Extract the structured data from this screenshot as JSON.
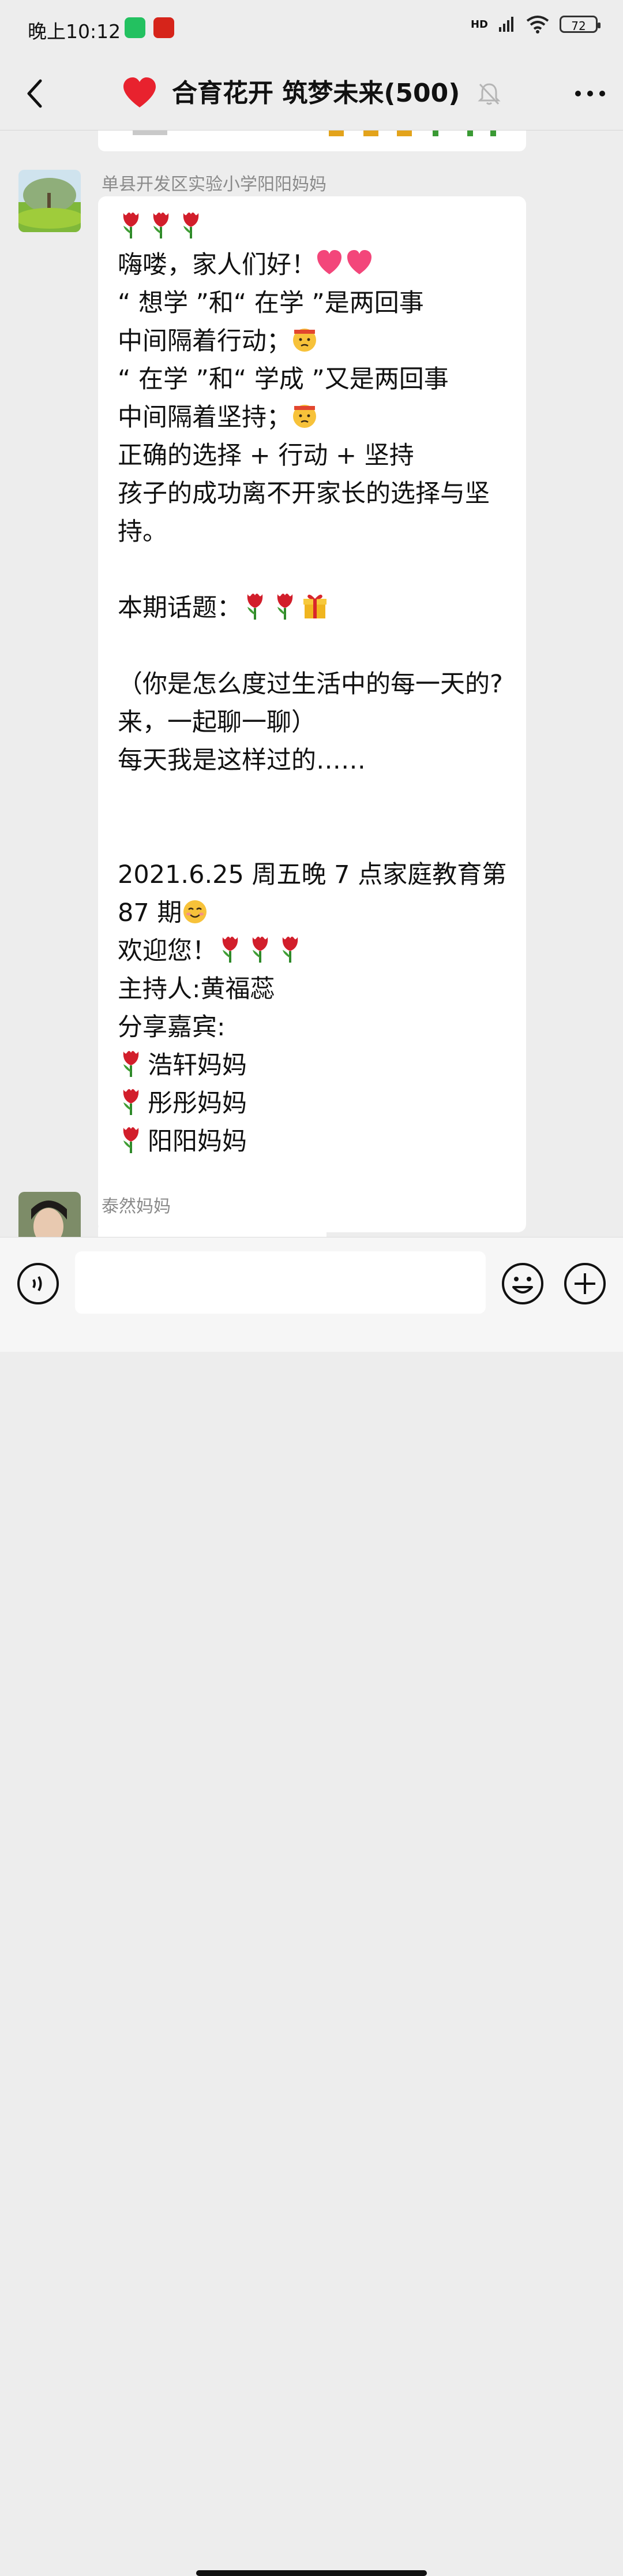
{
  "status_bar": {
    "time": "晚上10:12",
    "battery": "72",
    "network": "HD"
  },
  "header": {
    "title": "合育花开 筑梦未来(500)"
  },
  "messages": [
    {
      "sender": "单县开发区实验小学阳阳妈妈",
      "lines": [
        {
          "text": "",
          "emojis": [
            "tulip",
            "tulip",
            "tulip"
          ]
        },
        {
          "text": "嗨喽，家人们好！",
          "emojis": [
            "heart",
            "heart"
          ]
        },
        {
          "text": "“ 想学 ”和“ 在学 ”是两回事",
          "emojis": []
        },
        {
          "text": "中间隔着行动；",
          "emojis": [
            "determined-face"
          ]
        },
        {
          "text": "“ 在学 ”和“ 学成 ”又是两回事",
          "emojis": []
        },
        {
          "text": "中间隔着坚持；",
          "emojis": [
            "determined-face"
          ]
        },
        {
          "text": "正确的选择 + 行动 + 坚持",
          "emojis": []
        },
        {
          "text": "孩子的成功离不开家长的选择与坚",
          "emojis": []
        },
        {
          "text": "持。",
          "emojis": []
        },
        {
          "text": "",
          "emojis": []
        },
        {
          "text": "本期话题：",
          "emojis": [
            "tulip",
            "tulip",
            "gift"
          ]
        },
        {
          "text": "",
          "emojis": []
        },
        {
          "text": "（你是怎么度过生活中的每一天的?",
          "emojis": []
        },
        {
          "text": "来，一起聊一聊）",
          "emojis": []
        },
        {
          "text": "每天我是这样过的……",
          "emojis": []
        },
        {
          "text": "",
          "emojis": []
        },
        {
          "text": "",
          "emojis": []
        },
        {
          "text": "2021.6.25 周五晚 7 点家庭教育第",
          "emojis": []
        },
        {
          "text": "87 期",
          "emojis": [
            "smile"
          ]
        },
        {
          "text": "欢迎您！",
          "emojis": [
            "tulip",
            "tulip",
            "tulip"
          ]
        },
        {
          "text": "主持人:黄福蕊",
          "emojis": []
        },
        {
          "text": "分享嘉宾:",
          "emojis": []
        },
        {
          "text": "浩轩妈妈",
          "emojis": [
            "tulip"
          ],
          "lead": true
        },
        {
          "text": "彤彤妈妈",
          "emojis": [
            "tulip"
          ],
          "lead": true
        },
        {
          "text": "阳阳妈妈",
          "emojis": [
            "tulip"
          ],
          "lead": true
        }
      ]
    },
    {
      "sender": "泰然妈妈"
    }
  ],
  "colors": {
    "background": "#ededed",
    "bubble": "#ffffff",
    "sender_name": "#8a8a8a",
    "wechat_green": "#23c160"
  }
}
